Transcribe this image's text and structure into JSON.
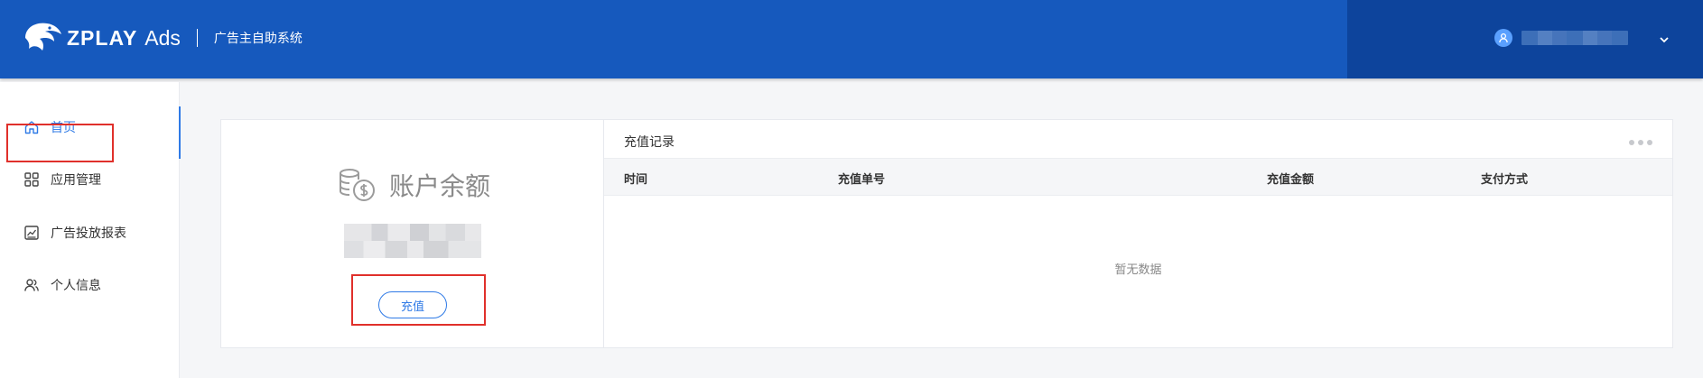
{
  "header": {
    "brand": "ZPLAY",
    "brand_suffix": "Ads",
    "subtitle": "广告主自助系统",
    "accent": "#1659bd",
    "user_panel_color": "#0d449c",
    "user_icon": "user-icon",
    "dropdown_icon": "chevron-down-icon"
  },
  "sidebar": {
    "items": [
      {
        "label": "首页",
        "icon": "home-icon",
        "active": true
      },
      {
        "label": "应用管理",
        "icon": "grid-icon",
        "active": false
      },
      {
        "label": "广告投放报表",
        "icon": "chart-icon",
        "active": false
      },
      {
        "label": "个人信息",
        "icon": "users-icon",
        "active": false
      }
    ],
    "active_color": "#2f7ae6"
  },
  "balance": {
    "title": "账户余额",
    "recharge_label": "充值",
    "icon": "coins-icon"
  },
  "records": {
    "title": "充值记录",
    "columns": [
      "时间",
      "充值单号",
      "充值金额",
      "支付方式"
    ],
    "rows": [],
    "empty_text": "暂无数据",
    "more_icon": "more-dots-icon"
  },
  "highlight_color": "#e0302b"
}
